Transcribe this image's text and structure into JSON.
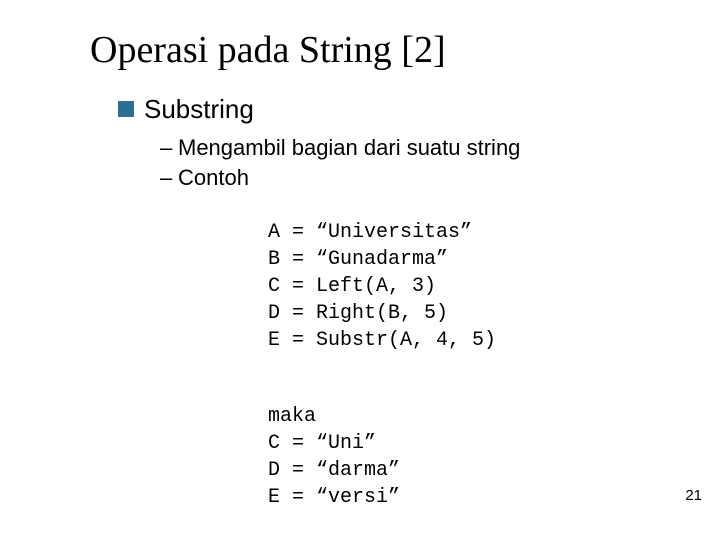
{
  "title": "Operasi pada String [2]",
  "section": {
    "heading": "Substring",
    "desc": "Mengambil bagian dari suatu string",
    "contoh_label": "Contoh",
    "code": [
      "A = “Universitas”",
      "B = “Gunadarma”",
      "C = Left(A, 3)",
      "D = Right(B, 5)",
      "E = Substr(A, 4, 5)"
    ],
    "result": [
      "maka",
      "C = “Uni”",
      "D = “darma”",
      "E = “versi”"
    ]
  },
  "page_number": "21"
}
